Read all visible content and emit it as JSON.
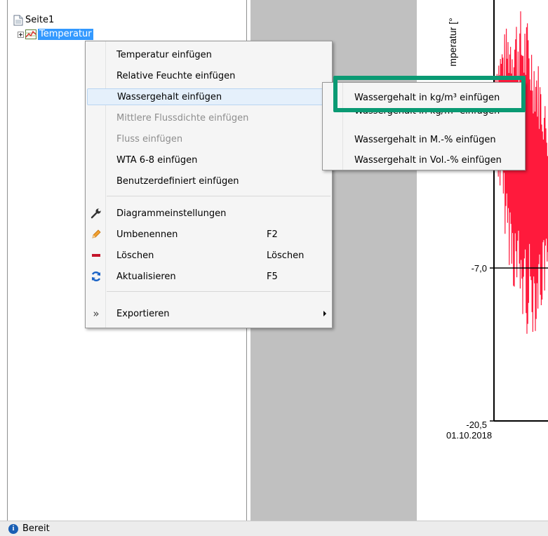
{
  "tree": {
    "root_label": "Seite1",
    "child_label": "Temperatur"
  },
  "chart": {
    "ylabel": "mperatur [°",
    "y_tick_mid": "-7,0",
    "y_tick_bottom": "-20,5",
    "x_tick_first": "01.10.2018",
    "series_color": "#ff1a3c"
  },
  "context_menu": {
    "items": [
      {
        "label": "Temperatur einfügen"
      },
      {
        "label": "Relative Feuchte einfügen"
      },
      {
        "label": "Wassergehalt einfügen"
      },
      {
        "label": "Mittlere Flussdichte einfügen"
      },
      {
        "label": "Fluss einfügen"
      },
      {
        "label": "WTA 6-8 einfügen"
      },
      {
        "label": "Benutzerdefiniert einfügen"
      },
      {
        "label": "Diagrammeinstellungen",
        "icon": "wrench-icon"
      },
      {
        "label": "Umbenennen",
        "shortcut": "F2",
        "icon": "pencil-icon"
      },
      {
        "label": "Löschen",
        "shortcut": "Löschen",
        "icon": "minus-icon"
      },
      {
        "label": "Aktualisieren",
        "shortcut": "F5",
        "icon": "refresh-icon"
      },
      {
        "label": "Exportieren",
        "icon": "double-chevron-icon"
      }
    ]
  },
  "submenu": {
    "items": [
      {
        "label": "Wassergehalt in kg/m³ einfügen"
      },
      {
        "label": "Wassergehalt in kg/m³ einfügen"
      },
      {
        "label": "Wassergehalt in M.-% einfügen"
      },
      {
        "label": "Wassergehalt in Vol.-% einfügen"
      }
    ]
  },
  "status": {
    "text": "Bereit"
  },
  "colors": {
    "highlight_box": "#0a9a73",
    "selection": "#3399ff"
  }
}
